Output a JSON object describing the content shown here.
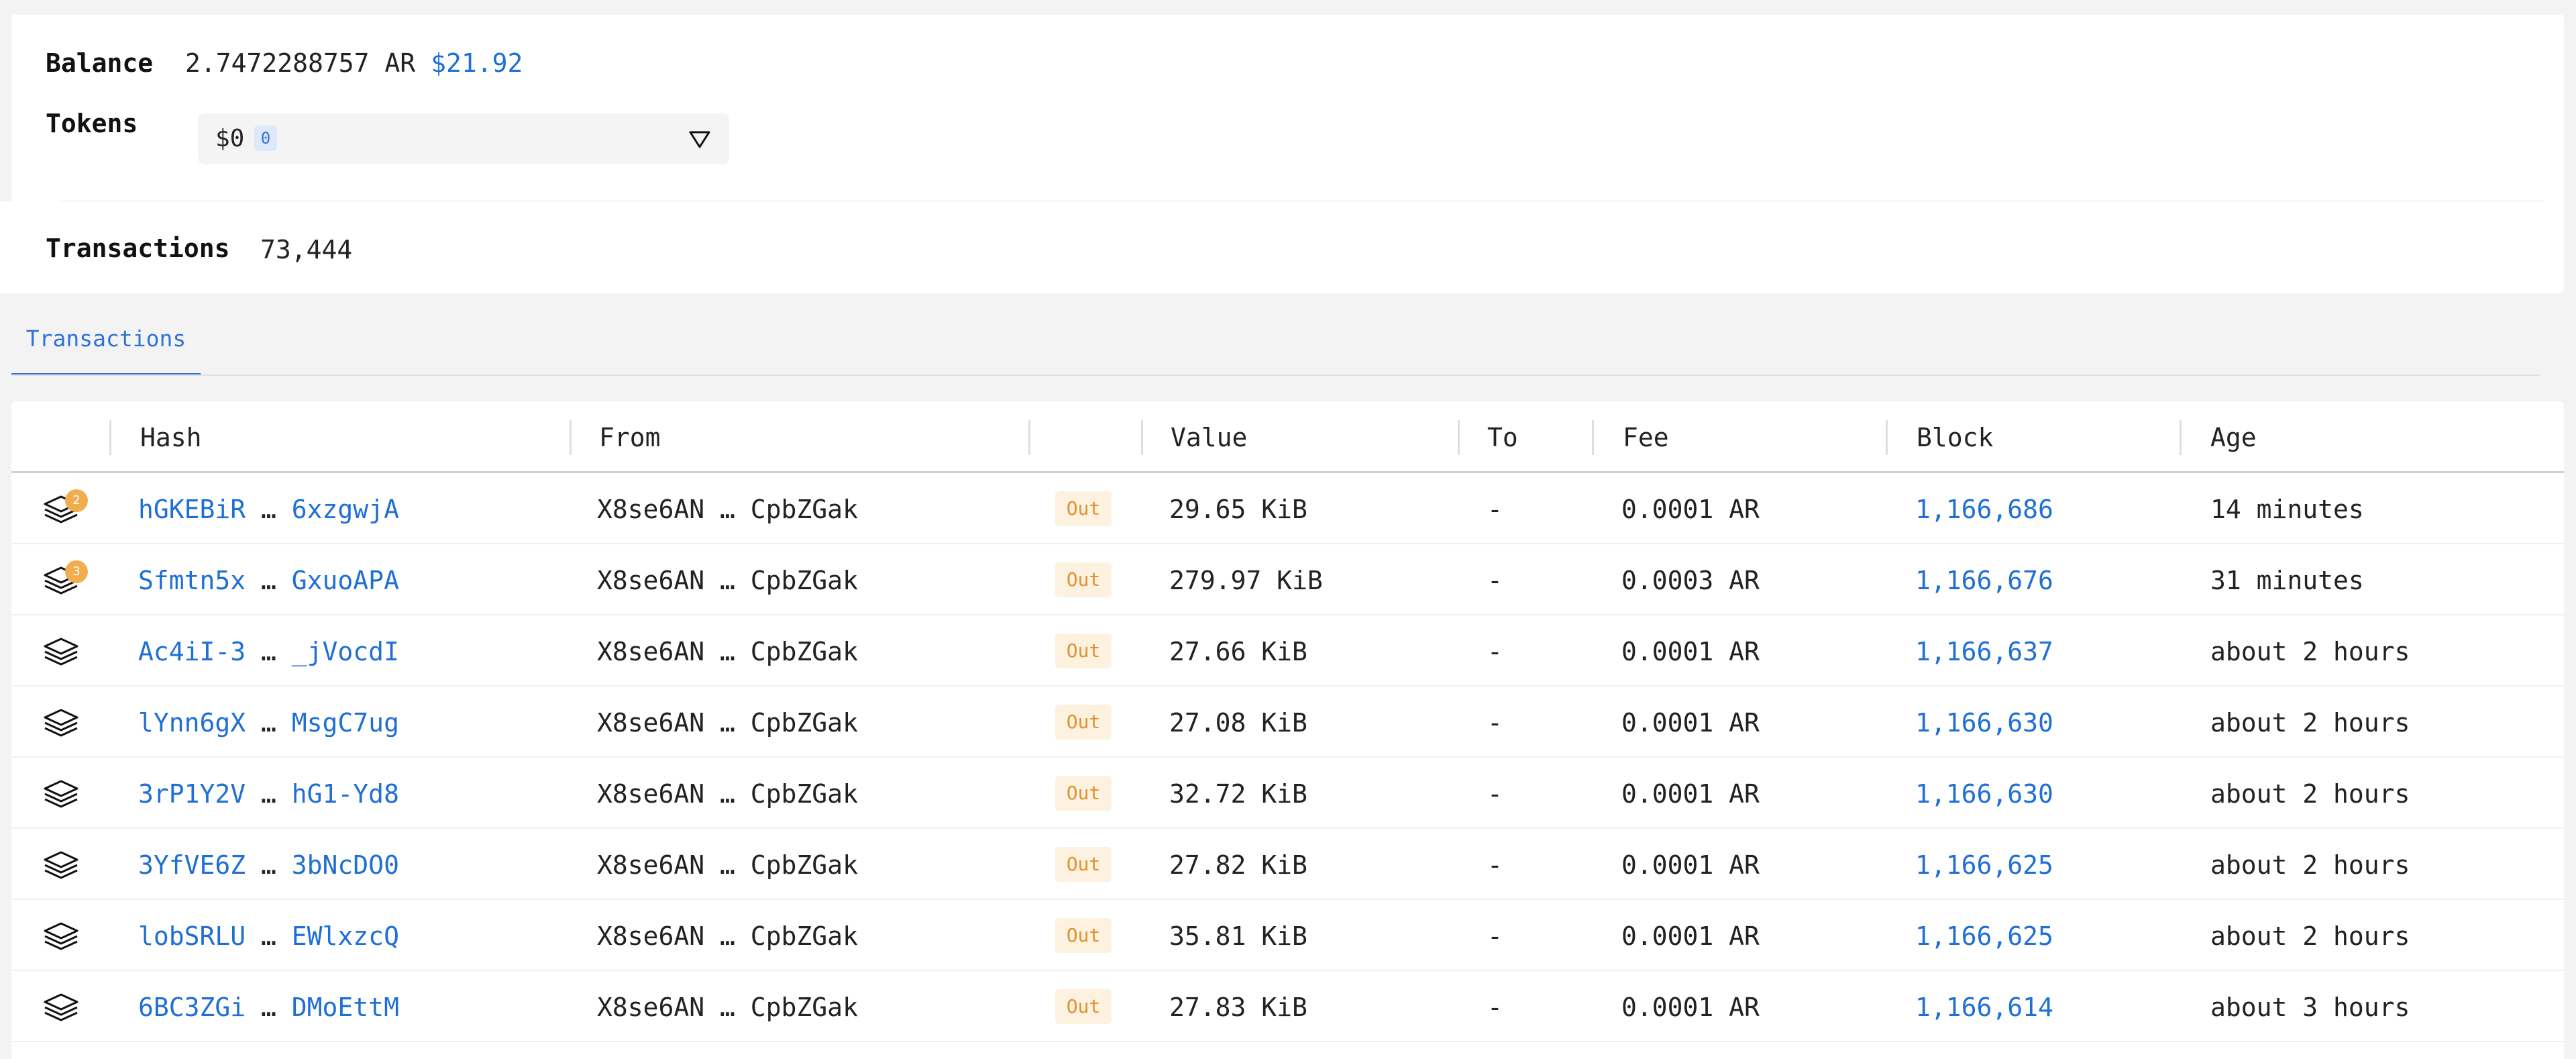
{
  "summary": {
    "balance_label": "Balance",
    "balance_value": "2.7472288757 AR",
    "balance_usd": "$21.92",
    "tokens_label": "Tokens",
    "tokens_value": "$0",
    "tokens_count": "0",
    "transactions_label": "Transactions",
    "transactions_count": "73,444"
  },
  "tabs": [
    {
      "label": "Transactions",
      "active": true
    }
  ],
  "table": {
    "headers": {
      "hash": "Hash",
      "from": "From",
      "value": "Value",
      "to": "To",
      "fee": "Fee",
      "block": "Block",
      "age": "Age"
    },
    "rows": [
      {
        "pending": true,
        "pending_count": "2",
        "hash_start": "hGKEBiR",
        "hash_end": "6xzgwjA",
        "from_start": "X8se6AN",
        "from_end": "CpbZGak",
        "direction": "Out",
        "value": "29.65 KiB",
        "to": "-",
        "fee": "0.0001 AR",
        "block": "1,166,686",
        "age": "14 minutes"
      },
      {
        "pending": true,
        "pending_count": "3",
        "hash_start": "Sfmtn5x",
        "hash_end": "GxuoAPA",
        "from_start": "X8se6AN",
        "from_end": "CpbZGak",
        "direction": "Out",
        "value": "279.97 KiB",
        "to": "-",
        "fee": "0.0003 AR",
        "block": "1,166,676",
        "age": "31 minutes"
      },
      {
        "pending": false,
        "pending_count": "",
        "hash_start": "Ac4iI-3",
        "hash_end": "_jVocdI",
        "from_start": "X8se6AN",
        "from_end": "CpbZGak",
        "direction": "Out",
        "value": "27.66 KiB",
        "to": "-",
        "fee": "0.0001 AR",
        "block": "1,166,637",
        "age": "about 2 hours"
      },
      {
        "pending": false,
        "pending_count": "",
        "hash_start": "lYnn6gX",
        "hash_end": "MsgC7ug",
        "from_start": "X8se6AN",
        "from_end": "CpbZGak",
        "direction": "Out",
        "value": "27.08 KiB",
        "to": "-",
        "fee": "0.0001 AR",
        "block": "1,166,630",
        "age": "about 2 hours"
      },
      {
        "pending": false,
        "pending_count": "",
        "hash_start": "3rP1Y2V",
        "hash_end": "hG1-Yd8",
        "from_start": "X8se6AN",
        "from_end": "CpbZGak",
        "direction": "Out",
        "value": "32.72 KiB",
        "to": "-",
        "fee": "0.0001 AR",
        "block": "1,166,630",
        "age": "about 2 hours"
      },
      {
        "pending": false,
        "pending_count": "",
        "hash_start": "3YfVE6Z",
        "hash_end": "3bNcDO0",
        "from_start": "X8se6AN",
        "from_end": "CpbZGak",
        "direction": "Out",
        "value": "27.82 KiB",
        "to": "-",
        "fee": "0.0001 AR",
        "block": "1,166,625",
        "age": "about 2 hours"
      },
      {
        "pending": false,
        "pending_count": "",
        "hash_start": "lobSRLU",
        "hash_end": "EWlxzcQ",
        "from_start": "X8se6AN",
        "from_end": "CpbZGak",
        "direction": "Out",
        "value": "35.81 KiB",
        "to": "-",
        "fee": "0.0001 AR",
        "block": "1,166,625",
        "age": "about 2 hours"
      },
      {
        "pending": false,
        "pending_count": "",
        "hash_start": "6BC3ZGi",
        "hash_end": "DMoEttM",
        "from_start": "X8se6AN",
        "from_end": "CpbZGak",
        "direction": "Out",
        "value": "27.83 KiB",
        "to": "-",
        "fee": "0.0001 AR",
        "block": "1,166,614",
        "age": "about 3 hours"
      }
    ]
  },
  "icons": {
    "tx_type": "layers-icon",
    "pending": "pending-dot-icon",
    "dropdown": "caret-down-icon"
  },
  "colors": {
    "link": "#1f6fd4",
    "out_badge_bg": "#fdf1df",
    "out_badge_text": "#e2902f",
    "pending": "#f2ad4f"
  }
}
